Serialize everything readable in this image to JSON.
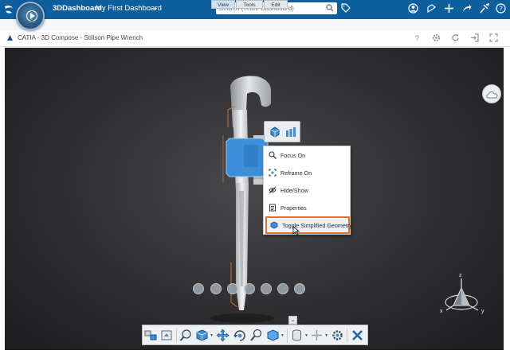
{
  "topbar": {
    "app_title": "3DDashboard",
    "dashboard_name": "My First Dashboard",
    "search_placeholder": "Search (Team Dashboard)"
  },
  "widget": {
    "title": "CATIA - 3D Compose - Stillson Pipe Wrench"
  },
  "context_menu": {
    "items": [
      {
        "label": "Focus On",
        "icon": "focus-icon"
      },
      {
        "label": "Reframe On",
        "icon": "reframe-icon"
      },
      {
        "label": "Hide/Show",
        "icon": "hide-show-icon"
      },
      {
        "label": "Properties",
        "icon": "properties-icon"
      },
      {
        "label": "Toggle Simplified Geometry",
        "icon": "simplified-geometry-icon",
        "highlighted": true
      }
    ]
  },
  "action_bar": {
    "tabs": [
      {
        "label": "View",
        "active": true
      },
      {
        "label": "Tools",
        "active": false
      },
      {
        "label": "Edit",
        "active": false
      }
    ]
  },
  "compass": {
    "axes": {
      "z": "z",
      "x": "x",
      "y": "y"
    }
  },
  "colors": {
    "brand_bar": "#0e5f9e",
    "highlight_border": "#e8702a",
    "selection_blue": "#3d8fd8"
  }
}
